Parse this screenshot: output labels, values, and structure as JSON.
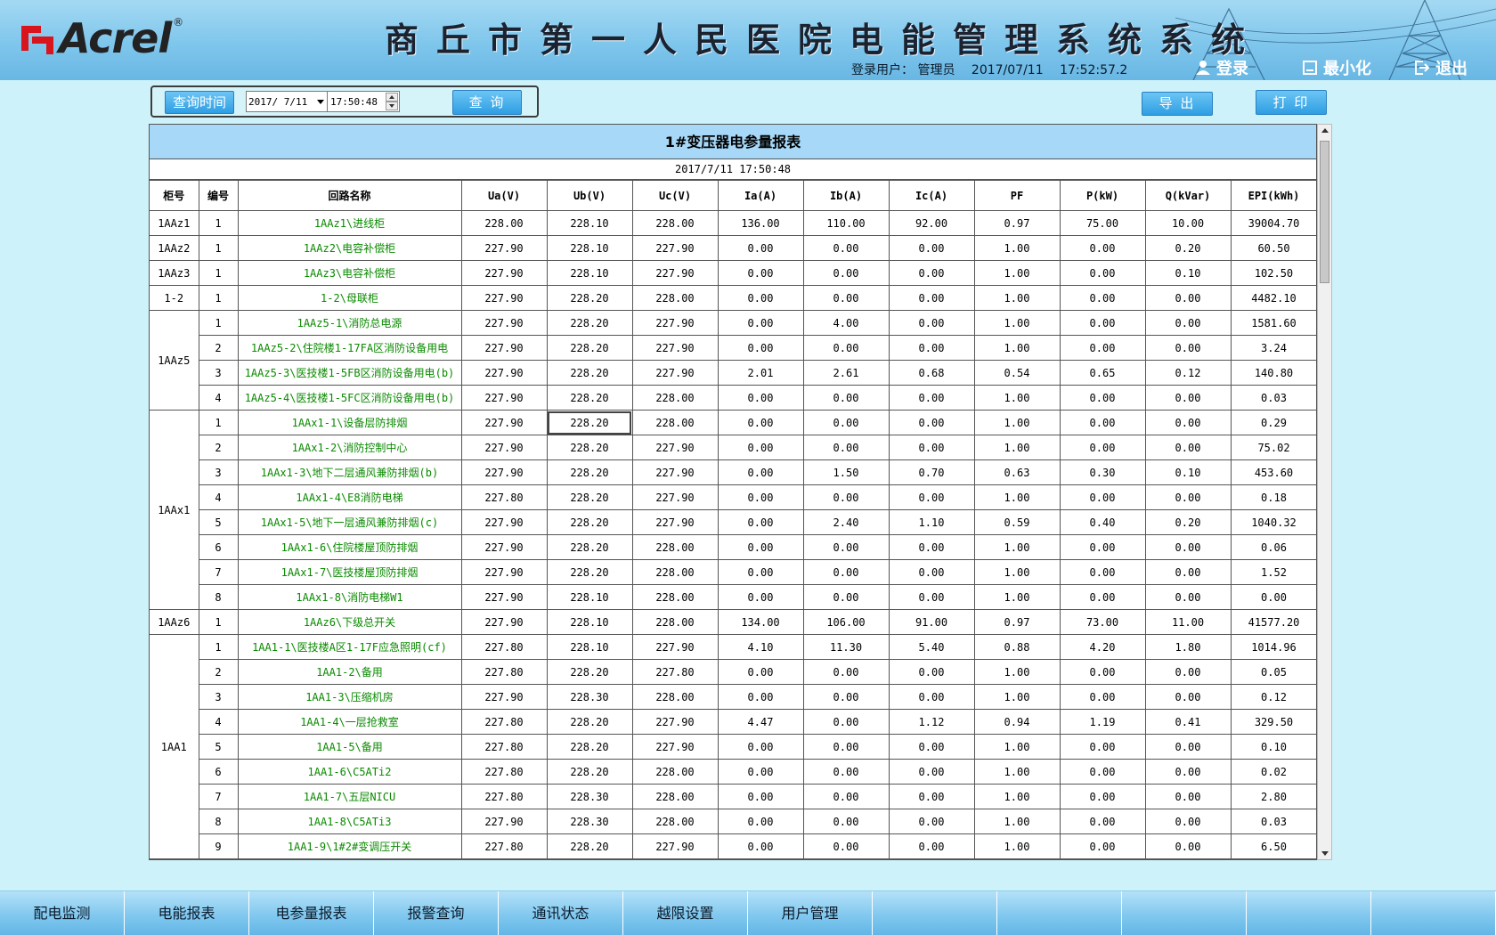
{
  "header": {
    "brand": "Acrel",
    "brand_reg": "®",
    "title": "商丘市第一人民医院电能管理系统系统",
    "login_label": "登录用户：",
    "user": "管理员",
    "date": "2017/07/11",
    "time": "17:52:57.2",
    "btn_login": "登录",
    "btn_minimize": "最小化",
    "btn_exit": "退出",
    "brand_red": "#d8141c"
  },
  "query": {
    "time_label": "查询时间",
    "date_value": "2017/ 7/11",
    "time_value": "17:50:48",
    "search_label": "查 询",
    "export_label": "导 出",
    "print_label": "打 印"
  },
  "report": {
    "title": "1#变压器电参量报表",
    "datetime": "2017/7/11 17:50:48",
    "columns": [
      "柜号",
      "编号",
      "回路名称",
      "Ua(V)",
      "Ub(V)",
      "Uc(V)",
      "Ia(A)",
      "Ib(A)",
      "Ic(A)",
      "PF",
      "P(kW)",
      "Q(kVar)",
      "EPI(kWh)"
    ],
    "groups": [
      {
        "cabinet": "1AAz1",
        "rows": [
          {
            "no": "1",
            "name": "1AAz1\\进线柜",
            "v": [
              "228.00",
              "228.10",
              "228.00",
              "136.00",
              "110.00",
              "92.00",
              "0.97",
              "75.00",
              "10.00",
              "39004.70"
            ]
          }
        ]
      },
      {
        "cabinet": "1AAz2",
        "rows": [
          {
            "no": "1",
            "name": "1AAz2\\电容补偿柜",
            "v": [
              "227.90",
              "228.10",
              "227.90",
              "0.00",
              "0.00",
              "0.00",
              "1.00",
              "0.00",
              "0.20",
              "60.50"
            ]
          }
        ]
      },
      {
        "cabinet": "1AAz3",
        "rows": [
          {
            "no": "1",
            "name": "1AAz3\\电容补偿柜",
            "v": [
              "227.90",
              "228.10",
              "227.90",
              "0.00",
              "0.00",
              "0.00",
              "1.00",
              "0.00",
              "0.10",
              "102.50"
            ]
          }
        ]
      },
      {
        "cabinet": "1-2",
        "rows": [
          {
            "no": "1",
            "name": "1-2\\母联柜",
            "v": [
              "227.90",
              "228.20",
              "228.00",
              "0.00",
              "0.00",
              "0.00",
              "1.00",
              "0.00",
              "0.00",
              "4482.10"
            ]
          }
        ]
      },
      {
        "cabinet": "1AAz5",
        "rows": [
          {
            "no": "1",
            "name": "1AAz5-1\\消防总电源",
            "v": [
              "227.90",
              "228.20",
              "227.90",
              "0.00",
              "4.00",
              "0.00",
              "1.00",
              "0.00",
              "0.00",
              "1581.60"
            ]
          },
          {
            "no": "2",
            "name": "1AAz5-2\\住院楼1-17FA区消防设备用电",
            "v": [
              "227.90",
              "228.20",
              "227.90",
              "0.00",
              "0.00",
              "0.00",
              "1.00",
              "0.00",
              "0.00",
              "3.24"
            ]
          },
          {
            "no": "3",
            "name": "1AAz5-3\\医技楼1-5FB区消防设备用电(b)",
            "v": [
              "227.90",
              "228.20",
              "227.90",
              "2.01",
              "2.61",
              "0.68",
              "0.54",
              "0.65",
              "0.12",
              "140.80"
            ]
          },
          {
            "no": "4",
            "name": "1AAz5-4\\医技楼1-5FC区消防设备用电(b)",
            "v": [
              "227.90",
              "228.20",
              "228.00",
              "0.00",
              "0.00",
              "0.00",
              "1.00",
              "0.00",
              "0.00",
              "0.03"
            ]
          }
        ]
      },
      {
        "cabinet": "1AAx1",
        "rows": [
          {
            "no": "1",
            "name": "1AAx1-1\\设备层防排烟",
            "v": [
              "227.90",
              "228.20",
              "228.00",
              "0.00",
              "0.00",
              "0.00",
              "1.00",
              "0.00",
              "0.00",
              "0.29"
            ]
          },
          {
            "no": "2",
            "name": "1AAx1-2\\消防控制中心",
            "v": [
              "227.90",
              "228.20",
              "227.90",
              "0.00",
              "0.00",
              "0.00",
              "1.00",
              "0.00",
              "0.00",
              "75.02"
            ]
          },
          {
            "no": "3",
            "name": "1AAx1-3\\地下二层通风兼防排烟(b)",
            "v": [
              "227.90",
              "228.20",
              "227.90",
              "0.00",
              "1.50",
              "0.70",
              "0.63",
              "0.30",
              "0.10",
              "453.60"
            ]
          },
          {
            "no": "4",
            "name": "1AAx1-4\\E8消防电梯",
            "v": [
              "227.80",
              "228.20",
              "227.90",
              "0.00",
              "0.00",
              "0.00",
              "1.00",
              "0.00",
              "0.00",
              "0.18"
            ]
          },
          {
            "no": "5",
            "name": "1AAx1-5\\地下一层通风兼防排烟(c)",
            "v": [
              "227.90",
              "228.20",
              "227.90",
              "0.00",
              "2.40",
              "1.10",
              "0.59",
              "0.40",
              "0.20",
              "1040.32"
            ]
          },
          {
            "no": "6",
            "name": "1AAx1-6\\住院楼屋顶防排烟",
            "v": [
              "227.90",
              "228.20",
              "228.00",
              "0.00",
              "0.00",
              "0.00",
              "1.00",
              "0.00",
              "0.00",
              "0.06"
            ]
          },
          {
            "no": "7",
            "name": "1AAx1-7\\医技楼屋顶防排烟",
            "v": [
              "227.90",
              "228.20",
              "228.00",
              "0.00",
              "0.00",
              "0.00",
              "1.00",
              "0.00",
              "0.00",
              "1.52"
            ]
          },
          {
            "no": "8",
            "name": "1AAx1-8\\消防电梯W1",
            "v": [
              "227.90",
              "228.10",
              "228.00",
              "0.00",
              "0.00",
              "0.00",
              "1.00",
              "0.00",
              "0.00",
              "0.00"
            ]
          }
        ]
      },
      {
        "cabinet": "1AAz6",
        "rows": [
          {
            "no": "1",
            "name": "1AAz6\\下级总开关",
            "v": [
              "227.90",
              "228.10",
              "228.00",
              "134.00",
              "106.00",
              "91.00",
              "0.97",
              "73.00",
              "11.00",
              "41577.20"
            ]
          }
        ]
      },
      {
        "cabinet": "1AA1",
        "rows": [
          {
            "no": "1",
            "name": "1AA1-1\\医技楼A区1-17F应急照明(cf)",
            "v": [
              "227.80",
              "228.10",
              "227.90",
              "4.10",
              "11.30",
              "5.40",
              "0.88",
              "4.20",
              "1.80",
              "1014.96"
            ]
          },
          {
            "no": "2",
            "name": "1AA1-2\\备用",
            "v": [
              "227.80",
              "228.20",
              "227.80",
              "0.00",
              "0.00",
              "0.00",
              "1.00",
              "0.00",
              "0.00",
              "0.05"
            ]
          },
          {
            "no": "3",
            "name": "1AA1-3\\压缩机房",
            "v": [
              "227.90",
              "228.30",
              "228.00",
              "0.00",
              "0.00",
              "0.00",
              "1.00",
              "0.00",
              "0.00",
              "0.12"
            ]
          },
          {
            "no": "4",
            "name": "1AA1-4\\一层抢救室",
            "v": [
              "227.80",
              "228.20",
              "227.90",
              "4.47",
              "0.00",
              "1.12",
              "0.94",
              "1.19",
              "0.41",
              "329.50"
            ]
          },
          {
            "no": "5",
            "name": "1AA1-5\\备用",
            "v": [
              "227.80",
              "228.20",
              "227.90",
              "0.00",
              "0.00",
              "0.00",
              "1.00",
              "0.00",
              "0.00",
              "0.10"
            ]
          },
          {
            "no": "6",
            "name": "1AA1-6\\C5ATi2",
            "v": [
              "227.80",
              "228.20",
              "228.00",
              "0.00",
              "0.00",
              "0.00",
              "1.00",
              "0.00",
              "0.00",
              "0.02"
            ]
          },
          {
            "no": "7",
            "name": "1AA1-7\\五层NICU",
            "v": [
              "227.80",
              "228.30",
              "228.00",
              "0.00",
              "0.00",
              "0.00",
              "1.00",
              "0.00",
              "0.00",
              "2.80"
            ]
          },
          {
            "no": "8",
            "name": "1AA1-8\\C5ATi3",
            "v": [
              "227.90",
              "228.30",
              "228.00",
              "0.00",
              "0.00",
              "0.00",
              "1.00",
              "0.00",
              "0.00",
              "0.03"
            ]
          },
          {
            "no": "9",
            "name": "1AA1-9\\1#2#变调压开关",
            "v": [
              "227.80",
              "228.20",
              "227.90",
              "0.00",
              "0.00",
              "0.00",
              "1.00",
              "0.00",
              "0.00",
              "6.50"
            ]
          }
        ]
      }
    ]
  },
  "nav": [
    "配电监测",
    "电能报表",
    "电参量报表",
    "报警查询",
    "通讯状态",
    "越限设置",
    "用户管理",
    "",
    "",
    "",
    "",
    ""
  ]
}
